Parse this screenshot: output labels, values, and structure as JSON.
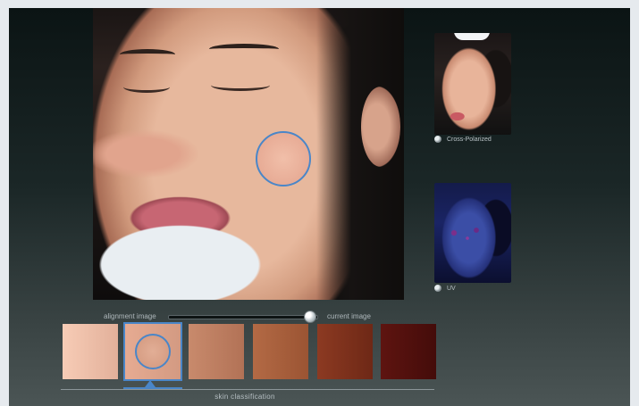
{
  "thumbnails": [
    {
      "label": "Cross-Polarized",
      "selected": false
    },
    {
      "label": "UV",
      "selected": false
    }
  ],
  "slider": {
    "left_label": "alignment image",
    "right_label": "current image",
    "value": 0.95
  },
  "skin_classification": {
    "label": "skin classification",
    "selected_index": 1,
    "swatches": [
      {
        "from": "#f7ccb6",
        "to": "#e2b09a"
      },
      {
        "from": "#e6ab92",
        "to": "#d39a82"
      },
      {
        "from": "#c88a6c",
        "to": "#b27256"
      },
      {
        "from": "#b36a45",
        "to": "#9b5433"
      },
      {
        "from": "#8c3a22",
        "to": "#6e2816"
      },
      {
        "from": "#5e1410",
        "to": "#440c0a"
      }
    ]
  },
  "colors": {
    "accent": "#4a86c8"
  }
}
